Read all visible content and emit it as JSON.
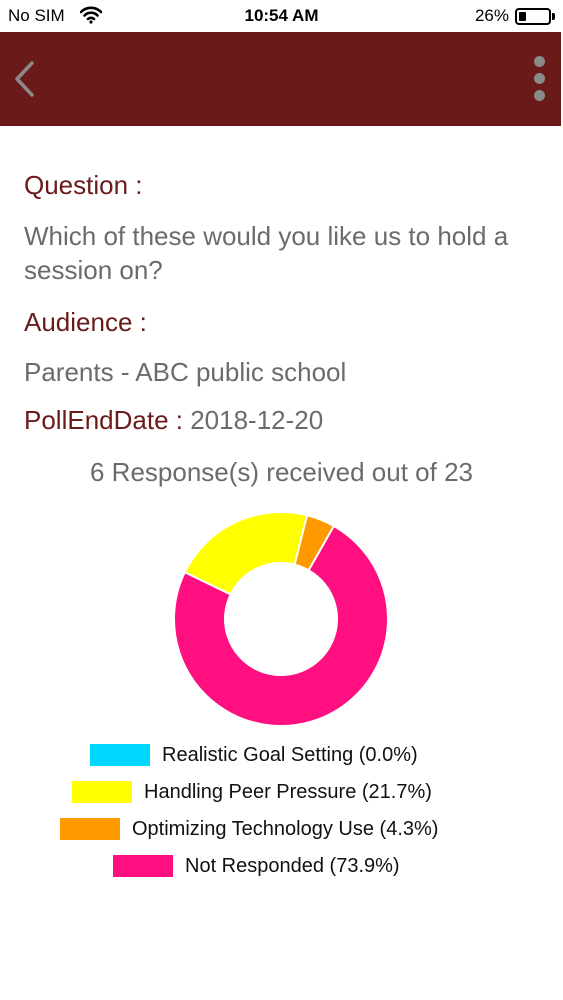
{
  "status_bar": {
    "carrier": "No SIM",
    "time": "10:54 AM",
    "battery_percent": "26%",
    "battery_level": 0.26,
    "icons": [
      "wifi-icon",
      "battery-icon"
    ]
  },
  "nav": {
    "icons": [
      "chevron-left-icon",
      "more-vertical-icon"
    ]
  },
  "poll": {
    "question_label": "Question :",
    "question_text": "Which of these would you like us to hold a session on?",
    "audience_label": "Audience :",
    "audience_text": "Parents - ABC public school",
    "end_date_label": "PollEndDate : ",
    "end_date_value": "2018-12-20",
    "responses_text": "6 Response(s) received out of 23"
  },
  "chart_data": {
    "type": "pie",
    "variant": "donut",
    "categories": [
      "Realistic Goal Setting",
      "Handling Peer Pressure",
      "Optimizing Technology Use",
      "Not Responded"
    ],
    "values": [
      0.0,
      21.7,
      4.3,
      73.9
    ],
    "colors": [
      "#00d8ff",
      "#ffff00",
      "#ff9900",
      "#ff0f7f"
    ],
    "legend_labels": [
      "Realistic Goal Setting (0.0%)",
      "Handling Peer Pressure (21.7%)",
      "Optimizing Technology Use (4.3%)",
      "Not Responded (73.9%)"
    ],
    "legend_position": "bottom"
  }
}
